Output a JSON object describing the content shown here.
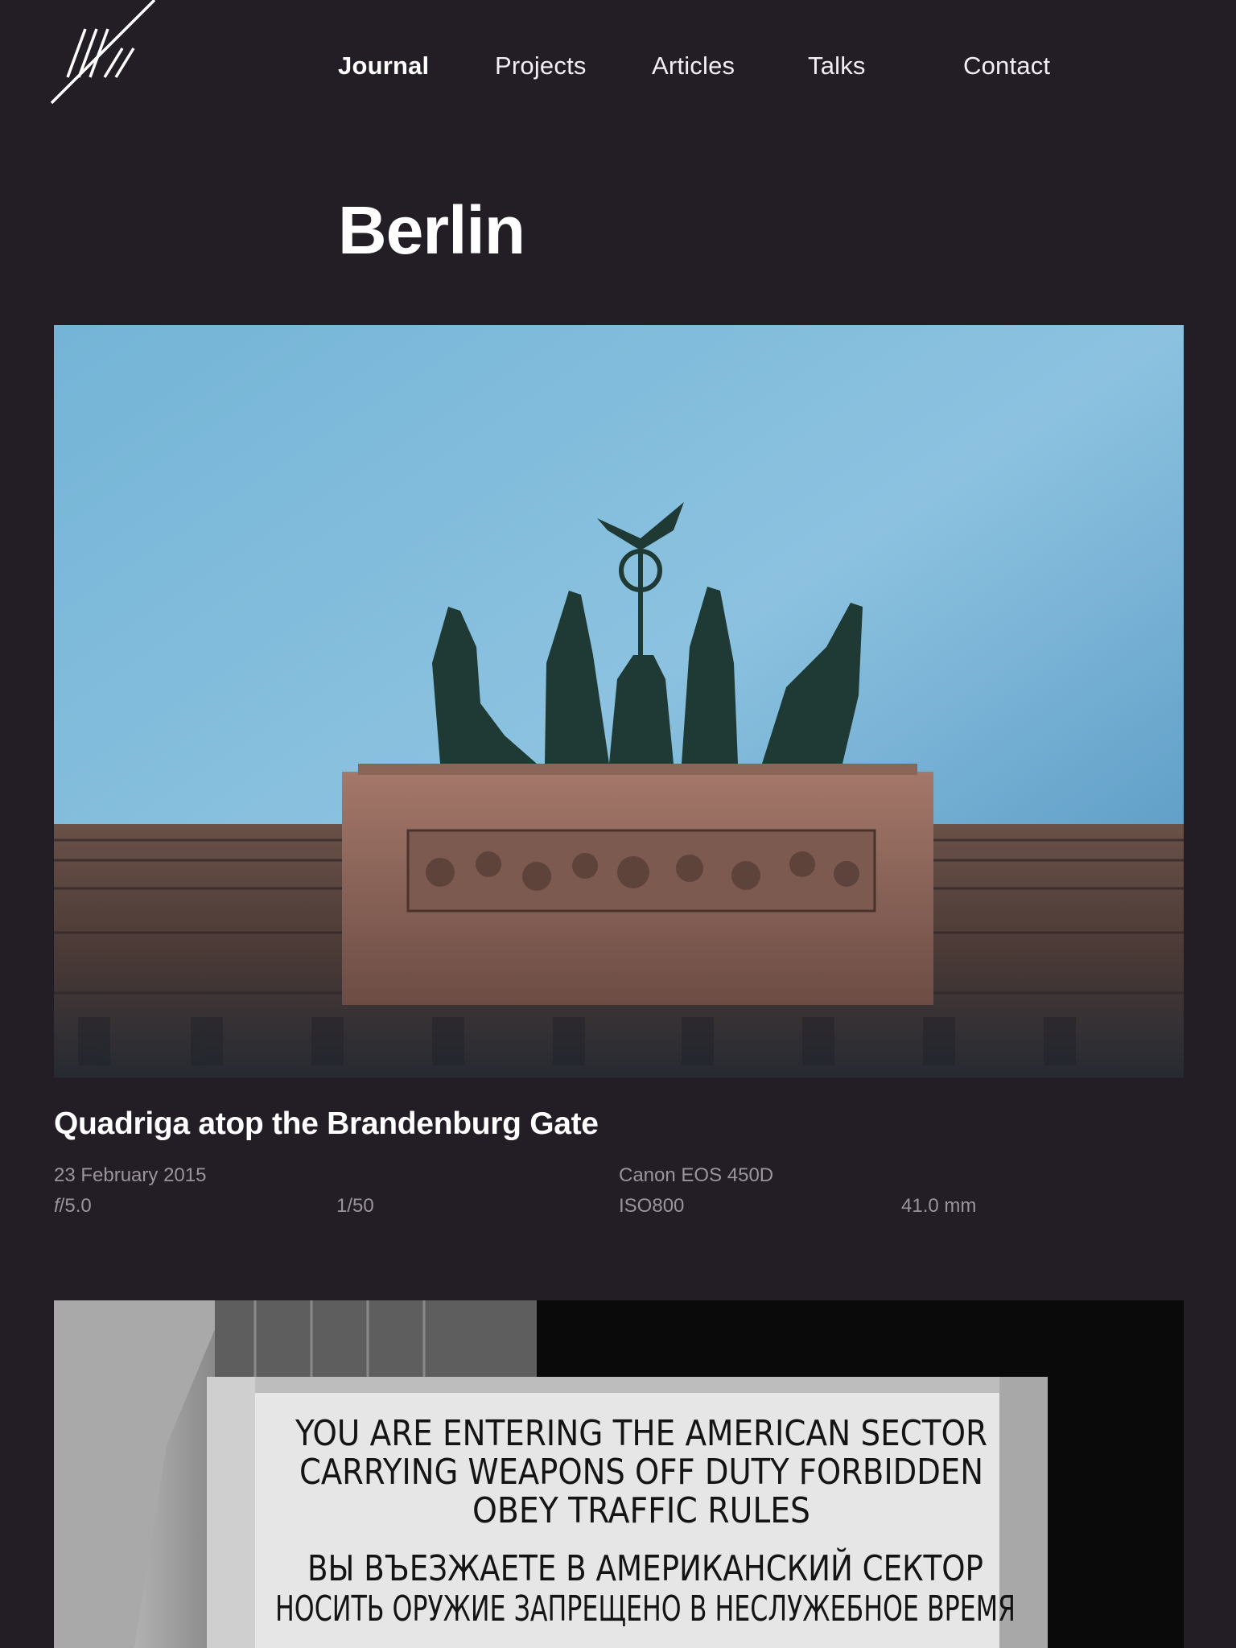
{
  "site": {
    "logo_icon": "stripes-logo-icon"
  },
  "nav": {
    "items": [
      {
        "label": "Journal",
        "active": true
      },
      {
        "label": "Projects",
        "active": false
      },
      {
        "label": "Articles",
        "active": false
      },
      {
        "label": "Talks",
        "active": false
      },
      {
        "label": "Contact",
        "active": false
      }
    ]
  },
  "page": {
    "title": "Berlin"
  },
  "photos": [
    {
      "title": "Quadriga atop the Brandenburg Gate",
      "date": "23 February 2015",
      "camera": "Canon EOS 450D",
      "aperture_prefix": "f",
      "aperture_value": "/5.0",
      "shutter": "1/50",
      "iso": "ISO800",
      "focal_length": "41.0 mm"
    },
    {
      "sign_lines": [
        "YOU ARE ENTERING THE AMERICAN SECTOR",
        "CARRYING WEAPONS OFF DUTY FORBIDDEN",
        "OBEY TRAFFIC RULES",
        "ВЫ ВЪЕЗЖАЕТЕ В АМЕРИКАНСКИЙ СЕКТОР",
        "НОСИТЬ ОРУЖИЕ ЗАПРЕЩЕНО В НЕСЛУЖЕБНОЕ ВРЕМЯ"
      ]
    }
  ],
  "colors": {
    "background": "#231d25",
    "text": "#ffffff",
    "meta_text": "#9b939e"
  }
}
